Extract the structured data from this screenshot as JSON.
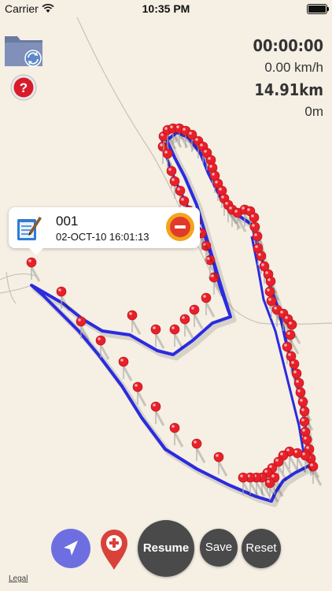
{
  "status_bar": {
    "carrier": "Carrier",
    "time": "10:35 PM"
  },
  "stats": {
    "elapsed": "00:00:00",
    "speed": "0.00 km/h",
    "distance": "14.91km",
    "altitude": "0m"
  },
  "callout": {
    "title": "001",
    "subtitle": "02-OCT-10 16:01:13"
  },
  "toolbar": {
    "resume_label": "Resume",
    "save_label": "Save",
    "reset_label": "Reset"
  },
  "map": {
    "legal_label": "Legal"
  },
  "colors": {
    "route": "#2b2be0",
    "pin": "#e8202a",
    "button_dark": "#4a4a4a",
    "locate": "#6d6fe0"
  }
}
